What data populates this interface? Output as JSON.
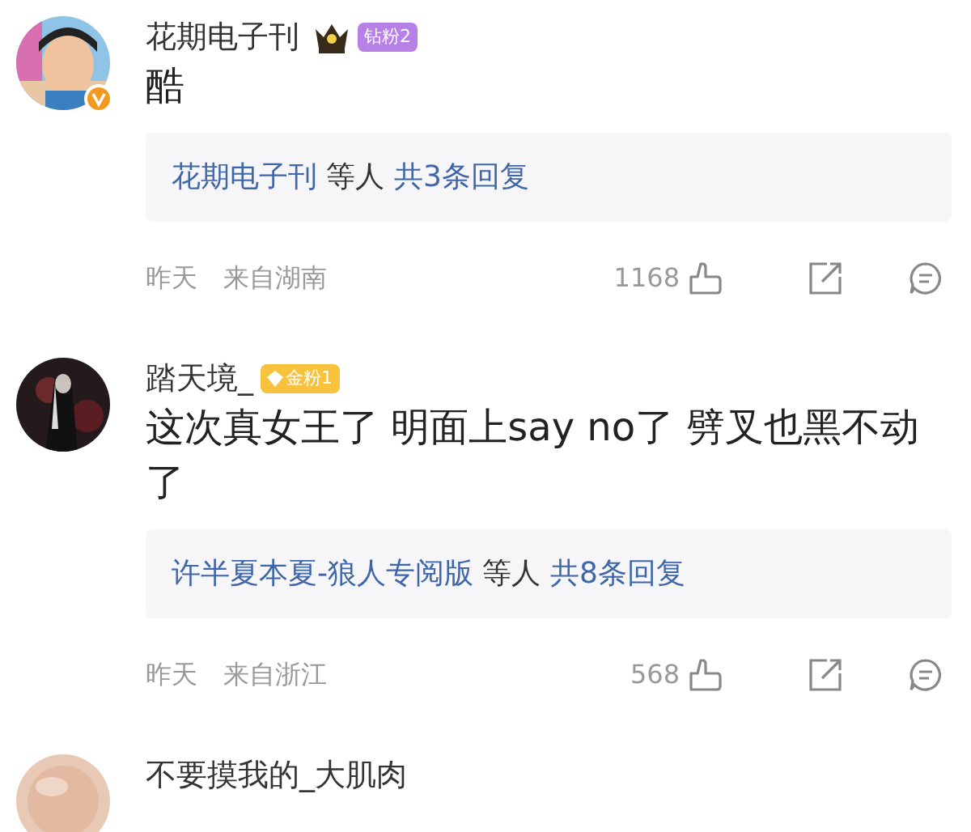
{
  "comments": [
    {
      "name": "花期电子刊",
      "badge": {
        "kind": "diamond",
        "label": "钻粉2"
      },
      "verified": true,
      "text": "酷",
      "reply": {
        "users": "花期电子刊",
        "joiner": "等人",
        "count": "共3条回复"
      },
      "time": "昨天",
      "location": "来自湖南",
      "likes": "1168"
    },
    {
      "name": "踏天境_",
      "badge": {
        "kind": "gold",
        "label": "金粉1"
      },
      "verified": false,
      "text": "这次真女王了 明面上say no了 劈叉也黑不动了",
      "reply": {
        "users": "许半夏本夏-狼人专阅版",
        "joiner": "等人",
        "count": "共8条回复"
      },
      "time": "昨天",
      "location": "来自浙江",
      "likes": "568"
    },
    {
      "name": "不要摸我的_大肌肉"
    }
  ]
}
